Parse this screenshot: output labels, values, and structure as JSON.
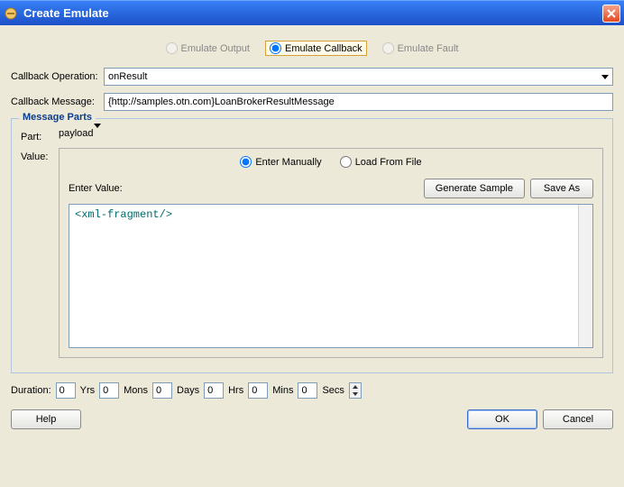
{
  "window": {
    "title": "Create Emulate"
  },
  "emulate_mode": {
    "output": "Emulate Output",
    "callback": "Emulate Callback",
    "fault": "Emulate Fault"
  },
  "callback_operation": {
    "label": "Callback Operation:",
    "value": "onResult"
  },
  "callback_message": {
    "label": "Callback Message:",
    "value": "{http://samples.otn.com}LoanBrokerResultMessage"
  },
  "message_parts": {
    "legend": "Message Parts",
    "part_label": "Part:",
    "part_value": "payload",
    "value_label": "Value:",
    "enter_manually": "Enter Manually",
    "load_from_file": "Load From File",
    "enter_value_label": "Enter Value:",
    "generate_sample": "Generate Sample",
    "save_as": "Save As",
    "editor_content": "<xml-fragment/>"
  },
  "duration": {
    "label": "Duration:",
    "yrs": {
      "value": "0",
      "unit": "Yrs"
    },
    "mons": {
      "value": "0",
      "unit": "Mons"
    },
    "days": {
      "value": "0",
      "unit": "Days"
    },
    "hrs": {
      "value": "0",
      "unit": "Hrs"
    },
    "mins": {
      "value": "0",
      "unit": "Mins"
    },
    "secs": {
      "value": "0",
      "unit": "Secs"
    }
  },
  "buttons": {
    "help": "Help",
    "ok": "OK",
    "cancel": "Cancel"
  }
}
